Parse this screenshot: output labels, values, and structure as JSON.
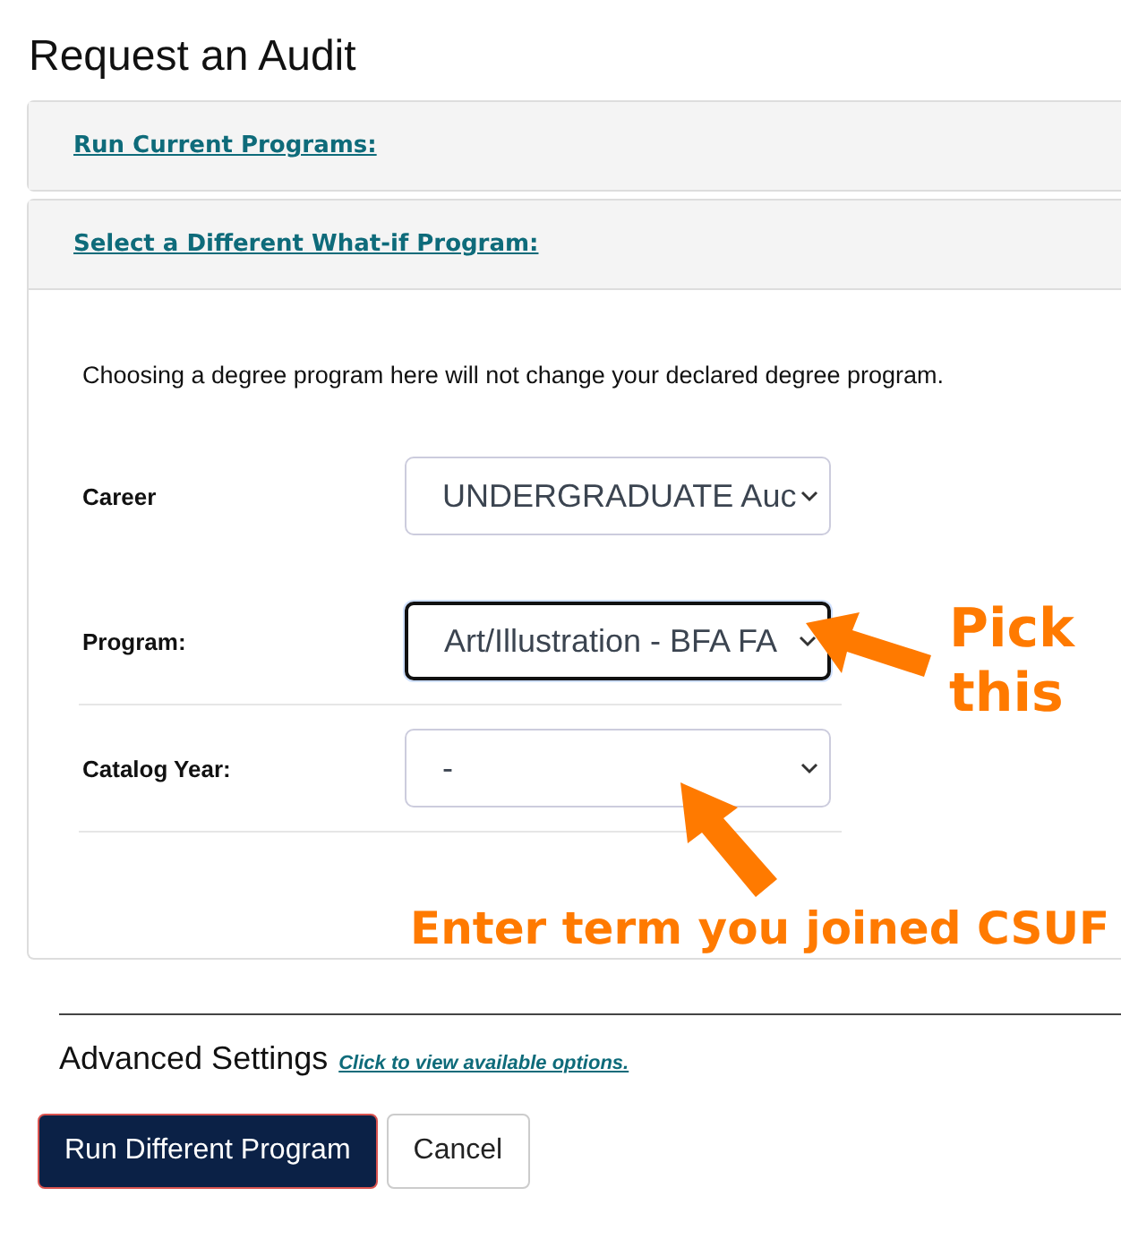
{
  "title": "Request an Audit",
  "sections": [
    {
      "label": "Run Current Programs:",
      "expanded": false
    },
    {
      "label": "Select a Different What-if Program:",
      "expanded": true
    }
  ],
  "notice": "Choosing a degree program here will not change your declared degree program.",
  "fields": [
    {
      "label": "Career",
      "value": "UNDERGRADUATE Auc",
      "focused": false
    },
    {
      "label": "Program:",
      "value": "Art/Illustration - BFA FA",
      "focused": true
    },
    {
      "label": "Catalog Year:",
      "value": "-",
      "focused": false
    }
  ],
  "advanced": {
    "heading": "Advanced Settings",
    "link": "Click to view available options."
  },
  "buttons": [
    {
      "label": "Run Different Program",
      "kind": "primary"
    },
    {
      "label": "Cancel",
      "kind": "secondary"
    }
  ],
  "annotations": [
    {
      "text": "Pick\nthis",
      "kind": "pick"
    },
    {
      "text": "Enter term you joined CSUF",
      "kind": "term"
    }
  ]
}
